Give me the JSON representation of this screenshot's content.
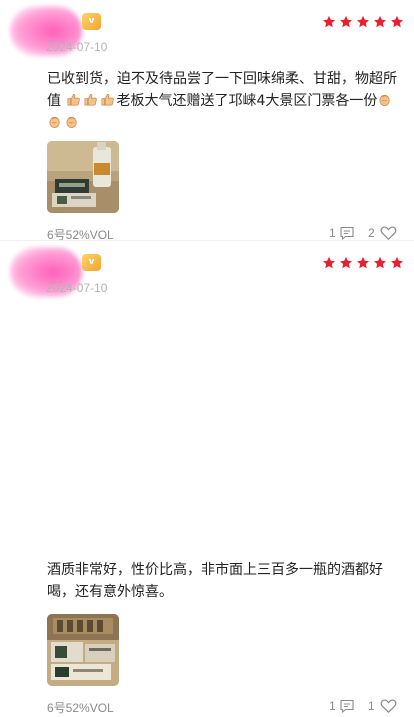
{
  "reviews": [
    {
      "level_badge": "v",
      "date": "2024-07-10",
      "rating": 5,
      "text_part1": "已收到货，迫不及待品尝了一下回味绵柔、甘甜，物超所值",
      "text_part2": "老板大气还赠送了邛崃4大景区门票各一份",
      "variant": "6号52%VOL",
      "comment_count": "1",
      "like_count": "2"
    },
    {
      "level_badge": "v",
      "date": "2024-07-10",
      "rating": 5,
      "text_part1": "酒质非常好，性价比高，非市面上三百多一瓶的酒都好喝，还有意外惊喜。",
      "variant": "6号52%VOL",
      "comment_count": "1",
      "like_count": "1"
    }
  ],
  "colors": {
    "star": "#e8202e",
    "date": "#b3b3b3",
    "meta": "#8a8a8a",
    "avatar": "#ff5fb8",
    "badge": "#f2a531"
  },
  "icons": {
    "star": "star-icon",
    "comment": "comment-icon",
    "like": "heart-icon",
    "emoji_thumb": "thumbs-up-icon",
    "emoji_clap": "clapping-hands-icon"
  }
}
